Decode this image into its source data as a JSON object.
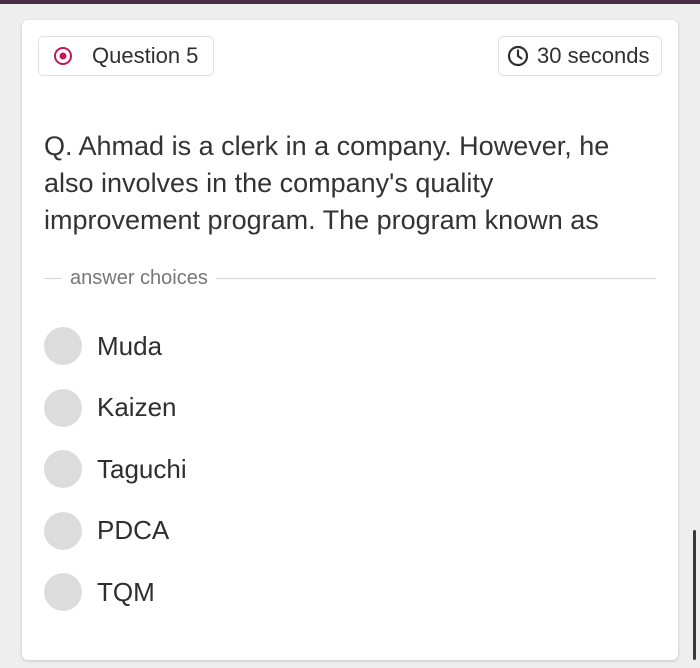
{
  "header": {
    "question_label": "Question 5",
    "question_icon": "target-circle-icon",
    "timer_label": "30 seconds",
    "timer_icon": "clock-icon"
  },
  "question": {
    "text": "Q. Ahmad is a clerk in a company. However, he also involves in the company's quality improvement program. The program known as"
  },
  "answers": {
    "section_label": "answer choices",
    "choices": [
      {
        "label": "Muda"
      },
      {
        "label": "Kaizen"
      },
      {
        "label": "Taguchi"
      },
      {
        "label": "PDCA"
      },
      {
        "label": "TQM"
      }
    ]
  },
  "colors": {
    "accent": "#c2185b",
    "radio": "#dcdcdc",
    "top_bar": "#4a2c4a"
  }
}
